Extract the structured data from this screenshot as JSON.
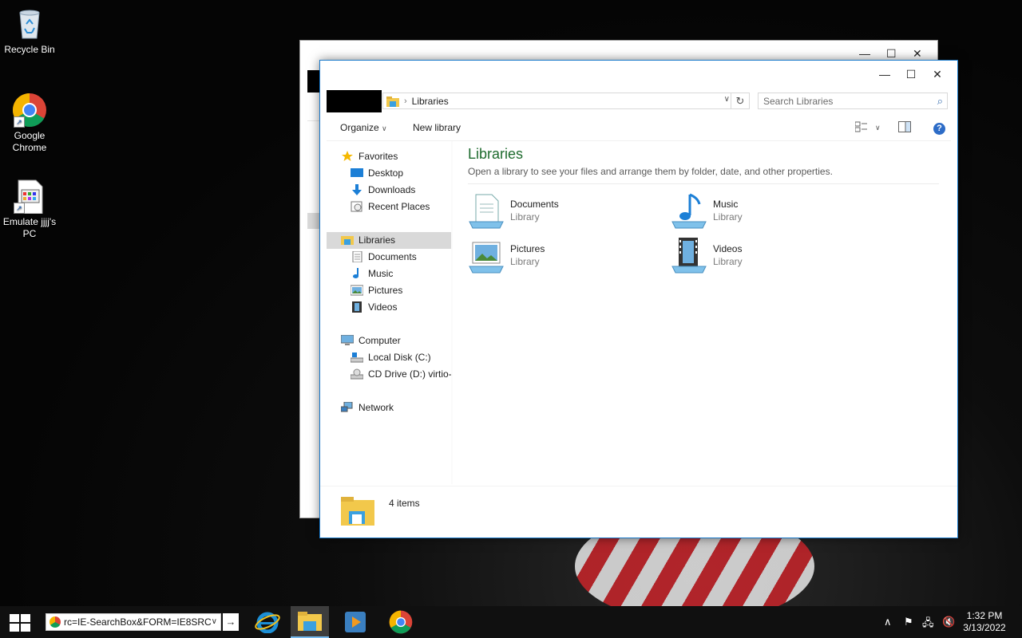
{
  "desktop": {
    "icons": [
      {
        "label": "Recycle Bin"
      },
      {
        "label": "Google Chrome"
      },
      {
        "label": "Emulate jjjj's PC"
      }
    ]
  },
  "window": {
    "address": {
      "location": "Libraries"
    },
    "search": {
      "placeholder": "Search Libraries"
    },
    "toolbar": {
      "organize": "Organize",
      "new_library": "New library"
    },
    "nav": {
      "favorites": "Favorites",
      "desktop": "Desktop",
      "downloads": "Downloads",
      "recent_places": "Recent Places",
      "libraries": "Libraries",
      "documents": "Documents",
      "music": "Music",
      "pictures": "Pictures",
      "videos": "Videos",
      "computer": "Computer",
      "local_disk": "Local Disk (C:)",
      "cd_drive": "CD Drive (D:) virtio-win",
      "network": "Network"
    },
    "content": {
      "title": "Libraries",
      "description": "Open a library to see your files and arrange them by folder, date, and other properties.",
      "items": [
        {
          "name": "Documents",
          "type": "Library"
        },
        {
          "name": "Music",
          "type": "Library"
        },
        {
          "name": "Pictures",
          "type": "Library"
        },
        {
          "name": "Videos",
          "type": "Library"
        }
      ]
    },
    "details": {
      "count": "4 items"
    }
  },
  "taskbar": {
    "address_value": "rc=IE-SearchBox&FORM=IE8SRC",
    "clock_time": "1:32 PM",
    "clock_date": "3/13/2022"
  },
  "colors": {
    "accent": "#1979ca",
    "title_green": "#1e6b2e",
    "taskbar": "#101010"
  }
}
